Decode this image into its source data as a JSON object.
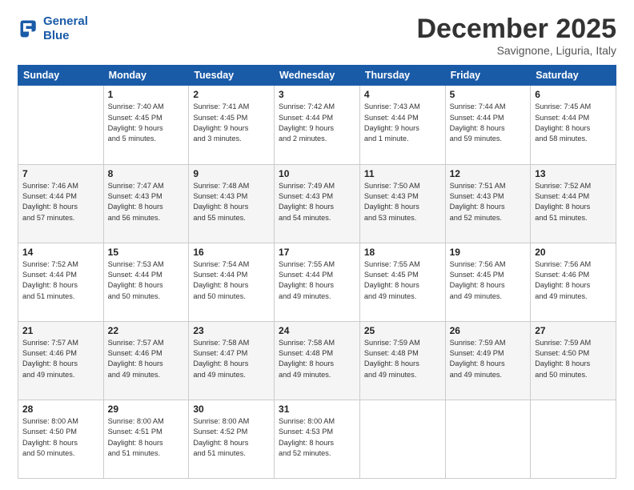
{
  "logo": {
    "line1": "General",
    "line2": "Blue"
  },
  "title": "December 2025",
  "subtitle": "Savignone, Liguria, Italy",
  "weekdays": [
    "Sunday",
    "Monday",
    "Tuesday",
    "Wednesday",
    "Thursday",
    "Friday",
    "Saturday"
  ],
  "weeks": [
    [
      {
        "day": "",
        "info": ""
      },
      {
        "day": "1",
        "info": "Sunrise: 7:40 AM\nSunset: 4:45 PM\nDaylight: 9 hours\nand 5 minutes."
      },
      {
        "day": "2",
        "info": "Sunrise: 7:41 AM\nSunset: 4:45 PM\nDaylight: 9 hours\nand 3 minutes."
      },
      {
        "day": "3",
        "info": "Sunrise: 7:42 AM\nSunset: 4:44 PM\nDaylight: 9 hours\nand 2 minutes."
      },
      {
        "day": "4",
        "info": "Sunrise: 7:43 AM\nSunset: 4:44 PM\nDaylight: 9 hours\nand 1 minute."
      },
      {
        "day": "5",
        "info": "Sunrise: 7:44 AM\nSunset: 4:44 PM\nDaylight: 8 hours\nand 59 minutes."
      },
      {
        "day": "6",
        "info": "Sunrise: 7:45 AM\nSunset: 4:44 PM\nDaylight: 8 hours\nand 58 minutes."
      }
    ],
    [
      {
        "day": "7",
        "info": "Sunrise: 7:46 AM\nSunset: 4:44 PM\nDaylight: 8 hours\nand 57 minutes."
      },
      {
        "day": "8",
        "info": "Sunrise: 7:47 AM\nSunset: 4:43 PM\nDaylight: 8 hours\nand 56 minutes."
      },
      {
        "day": "9",
        "info": "Sunrise: 7:48 AM\nSunset: 4:43 PM\nDaylight: 8 hours\nand 55 minutes."
      },
      {
        "day": "10",
        "info": "Sunrise: 7:49 AM\nSunset: 4:43 PM\nDaylight: 8 hours\nand 54 minutes."
      },
      {
        "day": "11",
        "info": "Sunrise: 7:50 AM\nSunset: 4:43 PM\nDaylight: 8 hours\nand 53 minutes."
      },
      {
        "day": "12",
        "info": "Sunrise: 7:51 AM\nSunset: 4:43 PM\nDaylight: 8 hours\nand 52 minutes."
      },
      {
        "day": "13",
        "info": "Sunrise: 7:52 AM\nSunset: 4:44 PM\nDaylight: 8 hours\nand 51 minutes."
      }
    ],
    [
      {
        "day": "14",
        "info": "Sunrise: 7:52 AM\nSunset: 4:44 PM\nDaylight: 8 hours\nand 51 minutes."
      },
      {
        "day": "15",
        "info": "Sunrise: 7:53 AM\nSunset: 4:44 PM\nDaylight: 8 hours\nand 50 minutes."
      },
      {
        "day": "16",
        "info": "Sunrise: 7:54 AM\nSunset: 4:44 PM\nDaylight: 8 hours\nand 50 minutes."
      },
      {
        "day": "17",
        "info": "Sunrise: 7:55 AM\nSunset: 4:44 PM\nDaylight: 8 hours\nand 49 minutes."
      },
      {
        "day": "18",
        "info": "Sunrise: 7:55 AM\nSunset: 4:45 PM\nDaylight: 8 hours\nand 49 minutes."
      },
      {
        "day": "19",
        "info": "Sunrise: 7:56 AM\nSunset: 4:45 PM\nDaylight: 8 hours\nand 49 minutes."
      },
      {
        "day": "20",
        "info": "Sunrise: 7:56 AM\nSunset: 4:46 PM\nDaylight: 8 hours\nand 49 minutes."
      }
    ],
    [
      {
        "day": "21",
        "info": "Sunrise: 7:57 AM\nSunset: 4:46 PM\nDaylight: 8 hours\nand 49 minutes."
      },
      {
        "day": "22",
        "info": "Sunrise: 7:57 AM\nSunset: 4:46 PM\nDaylight: 8 hours\nand 49 minutes."
      },
      {
        "day": "23",
        "info": "Sunrise: 7:58 AM\nSunset: 4:47 PM\nDaylight: 8 hours\nand 49 minutes."
      },
      {
        "day": "24",
        "info": "Sunrise: 7:58 AM\nSunset: 4:48 PM\nDaylight: 8 hours\nand 49 minutes."
      },
      {
        "day": "25",
        "info": "Sunrise: 7:59 AM\nSunset: 4:48 PM\nDaylight: 8 hours\nand 49 minutes."
      },
      {
        "day": "26",
        "info": "Sunrise: 7:59 AM\nSunset: 4:49 PM\nDaylight: 8 hours\nand 49 minutes."
      },
      {
        "day": "27",
        "info": "Sunrise: 7:59 AM\nSunset: 4:50 PM\nDaylight: 8 hours\nand 50 minutes."
      }
    ],
    [
      {
        "day": "28",
        "info": "Sunrise: 8:00 AM\nSunset: 4:50 PM\nDaylight: 8 hours\nand 50 minutes."
      },
      {
        "day": "29",
        "info": "Sunrise: 8:00 AM\nSunset: 4:51 PM\nDaylight: 8 hours\nand 51 minutes."
      },
      {
        "day": "30",
        "info": "Sunrise: 8:00 AM\nSunset: 4:52 PM\nDaylight: 8 hours\nand 51 minutes."
      },
      {
        "day": "31",
        "info": "Sunrise: 8:00 AM\nSunset: 4:53 PM\nDaylight: 8 hours\nand 52 minutes."
      },
      {
        "day": "",
        "info": ""
      },
      {
        "day": "",
        "info": ""
      },
      {
        "day": "",
        "info": ""
      }
    ]
  ]
}
